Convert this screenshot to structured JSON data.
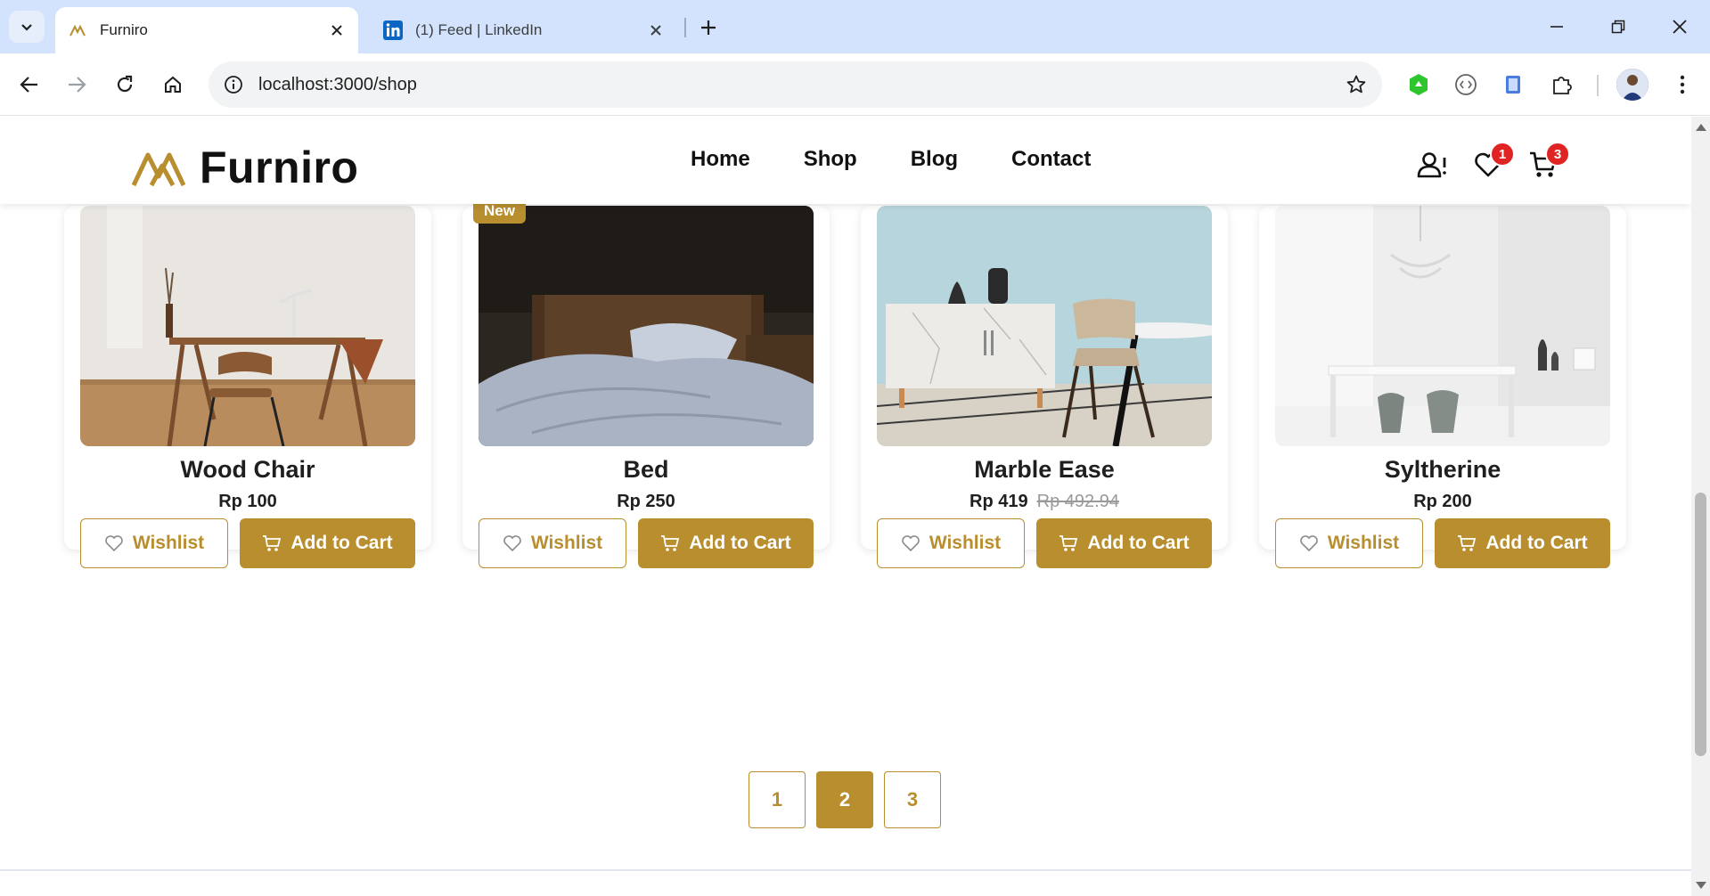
{
  "browser": {
    "tabs": [
      {
        "title": "Furniro",
        "active": true
      },
      {
        "title": "(1) Feed | LinkedIn",
        "active": false
      }
    ],
    "url": "localhost:3000/shop"
  },
  "header": {
    "brand": "Furniro",
    "nav": [
      "Home",
      "Shop",
      "Blog",
      "Contact"
    ],
    "wishlist_count": "1",
    "cart_count": "3"
  },
  "colors": {
    "accent": "#b88e2f",
    "badge": "#e02424"
  },
  "products": [
    {
      "name": "Wood Chair",
      "price": "Rp 100",
      "old_price": "",
      "badge": "",
      "wishlist_label": "Wishlist",
      "cart_label": "Add to Cart"
    },
    {
      "name": "Bed",
      "price": "Rp 250",
      "old_price": "",
      "badge": "New",
      "wishlist_label": "Wishlist",
      "cart_label": "Add to Cart"
    },
    {
      "name": "Marble Ease",
      "price": "Rp 419",
      "old_price": "Rp 492.94",
      "badge": "",
      "wishlist_label": "Wishlist",
      "cart_label": "Add to Cart"
    },
    {
      "name": "Syltherine",
      "price": "Rp 200",
      "old_price": "",
      "badge": "",
      "wishlist_label": "Wishlist",
      "cart_label": "Add to Cart"
    }
  ],
  "pagination": {
    "pages": [
      "1",
      "2",
      "3"
    ],
    "current": "2"
  }
}
